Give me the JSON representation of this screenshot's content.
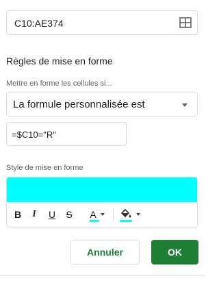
{
  "range": {
    "value": "C10:AE374",
    "icon": "grid-select-icon"
  },
  "section_title": "Règles de mise en forme",
  "condition": {
    "label": "Mettre en forme les cellules si...",
    "selected": "La formule personnalisée est",
    "formula": "=$C10=\"R\""
  },
  "style": {
    "label": "Style de mise en forme",
    "preview_color": "#00ffff",
    "toolbar": {
      "bold": "B",
      "italic": "I",
      "underline": "U",
      "strikethrough": "S",
      "text_color": "A",
      "text_color_value": "#00ffff",
      "fill_color_value": "#00ffff"
    }
  },
  "buttons": {
    "cancel": "Annuler",
    "ok": "OK"
  },
  "colors": {
    "accent_green": "#1e7e34",
    "border": "#dadce0"
  }
}
